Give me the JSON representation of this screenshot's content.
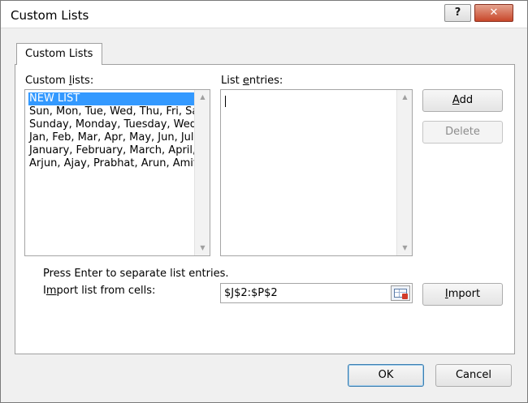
{
  "window": {
    "title": "Custom Lists",
    "help_label": "?",
    "close_label": "✕"
  },
  "tab": {
    "label": "Custom Lists"
  },
  "custom_lists": {
    "label_prefix": "Custom ",
    "label_hotkey": "l",
    "label_suffix": "ists:",
    "items": [
      "NEW LIST",
      "Sun, Mon, Tue, Wed, Thu, Fri, Sat",
      "Sunday, Monday, Tuesday, Wednesday, Thursday, Friday, Saturday",
      "Jan, Feb, Mar, Apr, May, Jun, Jul, Aug, Sep, Oct, Nov, Dec",
      "January, February, March, April, May, June, July, August, September, October, November, December",
      "Arjun, Ajay, Prabhat, Arun, Amit"
    ],
    "selected_index": 0
  },
  "list_entries": {
    "label_prefix": "List ",
    "label_hotkey": "e",
    "label_suffix": "ntries:",
    "value": ""
  },
  "buttons": {
    "add_hotkey": "A",
    "add_rest": "dd",
    "delete": "Delete",
    "import_hotkey": "I",
    "import_rest": "mport",
    "ok": "OK",
    "cancel": "Cancel"
  },
  "hint": "Press Enter to separate list entries.",
  "import_from_cells": {
    "label_prefix": "I",
    "label_hotkey": "m",
    "label_suffix": "port list from cells:",
    "value": "$J$2:$P$2"
  },
  "icons": {
    "scroll_up": "up-arrow-icon",
    "scroll_down": "down-arrow-icon",
    "range_picker": "range-selector-icon"
  }
}
